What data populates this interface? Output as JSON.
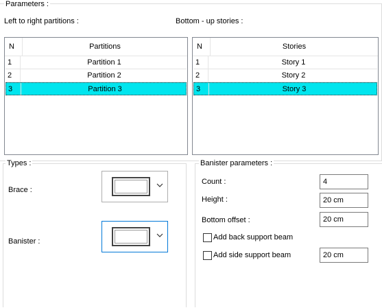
{
  "parameters": {
    "title": "Parameters :",
    "partitions_label": "Left to right partitions :",
    "stories_label": "Bottom - up stories :"
  },
  "partitions_grid": {
    "col_n": "N",
    "col_name": "Partitions",
    "rows": [
      {
        "n": "1",
        "name": "Partition 1",
        "selected": false
      },
      {
        "n": "2",
        "name": "Partition 2",
        "selected": false
      },
      {
        "n": "3",
        "name": "Partition 3",
        "selected": true
      }
    ]
  },
  "stories_grid": {
    "col_n": "N",
    "col_name": "Stories",
    "rows": [
      {
        "n": "1",
        "name": "Story 1",
        "selected": false
      },
      {
        "n": "2",
        "name": "Story 2",
        "selected": false
      },
      {
        "n": "3",
        "name": "Story 3",
        "selected": true
      }
    ]
  },
  "types": {
    "title": "Types :",
    "brace_label": "Brace :",
    "banister_label": "Banister :"
  },
  "banister_params": {
    "title": "Banister parameters :",
    "count_label": "Count :",
    "count_value": "4",
    "height_label": "Height :",
    "height_value": "20 cm",
    "offset_label": "Bottom offset :",
    "offset_value": "20 cm",
    "back_beam_label": "Add back support beam",
    "back_beam_checked": false,
    "side_beam_label": "Add side support beam",
    "side_beam_checked": false,
    "side_beam_value": "20 cm"
  },
  "colors": {
    "selection": "#00e5ee",
    "focus_border": "#0078d7",
    "group_border": "#dcdcdc"
  },
  "icons": [
    "chevron-down-icon",
    "rectangle-swatch-icon",
    "checkbox-icon"
  ]
}
